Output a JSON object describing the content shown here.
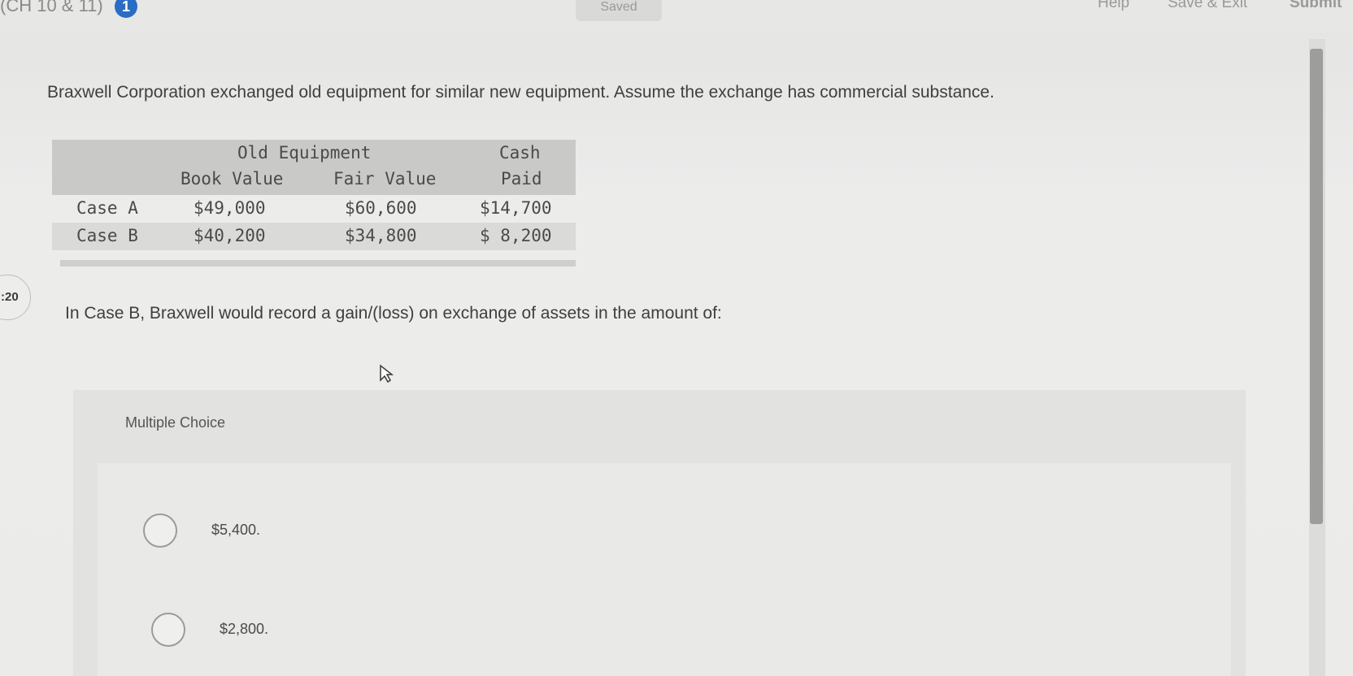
{
  "header": {
    "title": "(CH 10 & 11)",
    "info_badge": "1",
    "saved_label": "Saved",
    "help_label": "Help",
    "save_exit_label": "Save & Exit",
    "submit_label": "Submit"
  },
  "timer": {
    "text": ":20"
  },
  "question": {
    "prompt": "Braxwell Corporation exchanged old equipment for similar new equipment. Assume the exchange has commercial substance.",
    "text": "In Case B, Braxwell would record a gain/(loss) on exchange of assets in the amount of:"
  },
  "table": {
    "group_header": "Old Equipment",
    "cash_header_line1": "Cash",
    "cash_header_line2": "Paid",
    "col_book_value": "Book Value",
    "col_fair_value": "Fair Value",
    "rows": [
      {
        "label": "Case A",
        "book_value": "$49,000",
        "fair_value": "$60,600",
        "cash_paid": "$14,700"
      },
      {
        "label": "Case B",
        "book_value": "$40,200",
        "fair_value": "$34,800",
        "cash_paid": "$ 8,200"
      }
    ]
  },
  "multiple_choice": {
    "title": "Multiple Choice",
    "options": [
      {
        "label": "$5,400."
      },
      {
        "label": "$2,800."
      }
    ]
  }
}
